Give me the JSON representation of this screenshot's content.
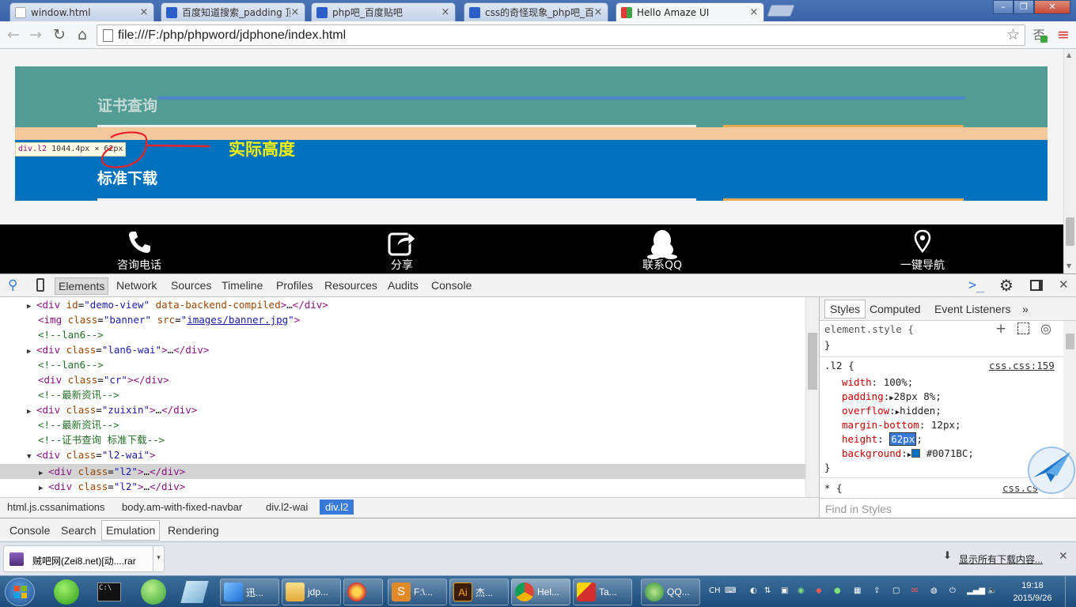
{
  "browser": {
    "tabs": [
      {
        "title": "window.html"
      },
      {
        "title": "百度知道搜索_padding 顶"
      },
      {
        "title": "php吧_百度贴吧"
      },
      {
        "title": "css的奇怪现象_php吧_百"
      },
      {
        "title": "Hello Amaze UI"
      }
    ],
    "url": "file:///F:/php/phpword/jdphone/index.html"
  },
  "page": {
    "cert_title": "证书查询",
    "std_title": "标准下载",
    "tooltip": {
      "tag": "div.l2",
      "size": "1044.4px × 62px"
    },
    "annotation": "实际高度",
    "navbar": [
      {
        "label": "咨询电话",
        "icon": "phone-icon"
      },
      {
        "label": "分享",
        "icon": "share-icon"
      },
      {
        "label": "联系QQ",
        "icon": "qq-icon"
      },
      {
        "label": "一键导航",
        "icon": "location-pin-icon"
      }
    ],
    "colors": {
      "green": "#529c93",
      "blue": "#0071bc",
      "peach": "#f3c89c",
      "annotation": "#f5f10c"
    }
  },
  "devtools": {
    "tabs": [
      "Elements",
      "Network",
      "Sources",
      "Timeline",
      "Profiles",
      "Resources",
      "Audits",
      "Console"
    ],
    "dom": [
      {
        "tag": "div",
        "attr1": "id",
        "val1": "demo-view",
        "attr2": "data-backend-compiled",
        "text": "…"
      },
      {
        "img_class": "banner",
        "img_src": "images/banner.jpg"
      },
      {
        "comment": "<!--lan6-->"
      },
      {
        "tag": "div",
        "attr1": "class",
        "val1": "lan6-wai",
        "text": "…"
      },
      {
        "comment": "<!--lan6-->"
      },
      {
        "tag": "div",
        "attr1": "class",
        "val1": "cr",
        "text": ""
      },
      {
        "comment": "<!--最新资讯-->"
      },
      {
        "tag": "div",
        "attr1": "class",
        "val1": "zuixin",
        "text": "…"
      },
      {
        "comment": "<!--最新资讯-->"
      },
      {
        "comment": "<!--证书查询 标准下载-->"
      },
      {
        "tag": "div",
        "attr1": "class",
        "val1": "l2-wai"
      },
      {
        "tag": "div",
        "attr1": "class",
        "val1": "l2",
        "text": "…"
      },
      {
        "tag": "div",
        "attr1": "class",
        "val1": "l2",
        "text": "…"
      }
    ],
    "breadcrumbs": [
      "html.js.cssanimations",
      "body.am-with-fixed-navbar",
      "div.l2-wai",
      "div.l2"
    ],
    "styles_tabs": [
      "Styles",
      "Computed",
      "Event Listeners"
    ],
    "element_style": "element.style {",
    "rule": {
      "selector": ".l2 {",
      "source": "css.css:159",
      "props": [
        {
          "name": "width",
          "value": "100%;"
        },
        {
          "name": "padding",
          "value": "28px 8%;"
        },
        {
          "name": "overflow",
          "value": "hidden;"
        },
        {
          "name": "margin-bottom",
          "value": "12px;"
        },
        {
          "name": "height",
          "value": "62px"
        },
        {
          "name": "background",
          "value": "#0071BC;"
        }
      ]
    },
    "next_rule": {
      "selector": "* {",
      "source": "css.cs"
    },
    "find_placeholder": "Find in Styles",
    "drawer_tabs": [
      "Console",
      "Search",
      "Emulation",
      "Rendering"
    ]
  },
  "downloads": {
    "file": "贼吧网(Zei8.net)[动....rar",
    "show_all": "显示所有下载内容..."
  },
  "taskbar": {
    "items": [
      {
        "label": "迅..."
      },
      {
        "label": "jdp..."
      },
      {
        "label": ""
      },
      {
        "label": "F:\\..."
      },
      {
        "label": "杰..."
      },
      {
        "label": "Hel..."
      },
      {
        "label": "Ta..."
      },
      {
        "label": "QQ..."
      }
    ],
    "time": "19:18",
    "date": "2015/9/26",
    "ime": "CH"
  }
}
